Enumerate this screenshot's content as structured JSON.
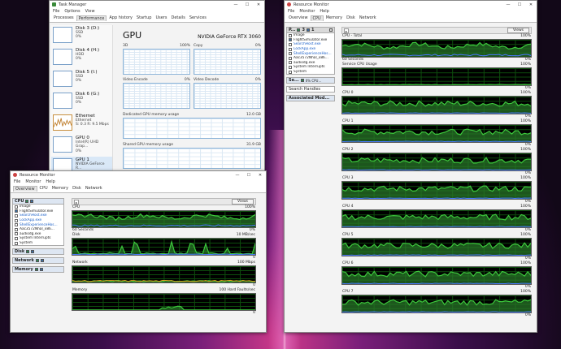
{
  "colors": {
    "graph_line": "#3cc83c",
    "graph_fill": "#2a7a2a",
    "graph_blue": "#4a7aff",
    "graph_orange": "#d8a020"
  },
  "task_manager": {
    "title": "Task Manager",
    "menu": [
      "File",
      "Options",
      "View"
    ],
    "tabs": [
      "Processes",
      "Performance",
      "App history",
      "Startup",
      "Users",
      "Details",
      "Services"
    ],
    "active_tab": "Performance",
    "devices": [
      {
        "name": "Disk 3 (D:)",
        "sub": "SSD",
        "val": "0%"
      },
      {
        "name": "Disk 4 (H:)",
        "sub": "HDD",
        "val": "0%"
      },
      {
        "name": "Disk 5 (I:)",
        "sub": "SSD",
        "val": "0%"
      },
      {
        "name": "Disk 6 (G:)",
        "sub": "SSD",
        "val": "0%"
      },
      {
        "name": "Ethernet",
        "sub": "Ethernet",
        "val": "S: 0.3 R: 9.5 Mbps"
      },
      {
        "name": "GPU 0",
        "sub": "Intel(R) UHD Grap...",
        "val": "0%"
      },
      {
        "name": "GPU 1",
        "sub": "NVIDIA GeForce R...",
        "val": "3% (53 °C)"
      }
    ],
    "gpu_heading": "GPU",
    "gpu_name": "NVIDIA GeForce RTX 3060",
    "engines": [
      {
        "name": "3D",
        "val": "100%",
        "right": "0%"
      },
      {
        "name": "Copy",
        "val": "",
        "right": "0%"
      },
      {
        "name": "Video Encode",
        "val": "",
        "right": "0%"
      },
      {
        "name": "Video Decode",
        "val": "",
        "right": "0%"
      }
    ],
    "dedicated_label": "Dedicated GPU memory usage",
    "dedicated_max": "12.0 GB",
    "shared_label": "Shared GPU memory usage",
    "shared_max": "31.9 GB"
  },
  "rm_large": {
    "title": "Resource Monitor",
    "menu": [
      "File",
      "Monitor",
      "Help"
    ],
    "tabs": [
      "Overview",
      "CPU",
      "Memory",
      "Disk",
      "Network"
    ],
    "active_tab": "CPU",
    "proc_header": "P...",
    "proc_header_stat": "3",
    "proc_header_stat2": "1",
    "processes": [
      {
        "name": "Image",
        "checked": false,
        "blue": false
      },
      {
        "name": "FlightSimulator.exe",
        "checked": true,
        "blue": false
      },
      {
        "name": "SearchHost.exe",
        "checked": false,
        "blue": true
      },
      {
        "name": "LockApp.exe",
        "checked": false,
        "blue": true
      },
      {
        "name": "ShellExperienceHos...",
        "checked": false,
        "blue": true
      },
      {
        "name": "Aac3572Nhal_x86...",
        "checked": false,
        "blue": false
      },
      {
        "name": "audiodg.exe",
        "checked": false,
        "blue": false
      },
      {
        "name": "System Interrupts",
        "checked": false,
        "blue": false
      },
      {
        "name": "System",
        "checked": false,
        "blue": false
      }
    ],
    "services_header": "Se...",
    "services_stat": "0% CPU...",
    "handles_label": "Search Handles",
    "modules_label": "Associated Mod...",
    "views_label": "Views",
    "graphs": [
      {
        "title": "CPU - Total",
        "max": "100%",
        "foot_left": "60 Seconds",
        "foot_right": "0%",
        "kind": "total"
      },
      {
        "title": "Service CPU Usage",
        "max": "100%",
        "foot_left": "",
        "foot_right": "0%",
        "kind": "service"
      },
      {
        "title": "CPU 0",
        "max": "100%",
        "foot_left": "",
        "foot_right": "0%",
        "kind": "core"
      },
      {
        "title": "CPU 1",
        "max": "100%",
        "foot_left": "",
        "foot_right": "0%",
        "kind": "core"
      },
      {
        "title": "CPU 2",
        "max": "100%",
        "foot_left": "",
        "foot_right": "0%",
        "kind": "core"
      },
      {
        "title": "CPU 3",
        "max": "100%",
        "foot_left": "",
        "foot_right": "0%",
        "kind": "core"
      },
      {
        "title": "CPU 4",
        "max": "100%",
        "foot_left": "",
        "foot_right": "0%",
        "kind": "core"
      },
      {
        "title": "CPU 5",
        "max": "100%",
        "foot_left": "",
        "foot_right": "0%",
        "kind": "core"
      },
      {
        "title": "CPU 6",
        "max": "100%",
        "foot_left": "",
        "foot_right": "0%",
        "kind": "core"
      },
      {
        "title": "CPU 7",
        "max": "100%",
        "foot_left": "",
        "foot_right": "0%",
        "kind": "core"
      }
    ]
  },
  "rm_small": {
    "title": "Resource Monitor",
    "menu": [
      "File",
      "Monitor",
      "Help"
    ],
    "tabs": [
      "Overview",
      "CPU",
      "Memory",
      "Disk",
      "Network"
    ],
    "active_tab": "Overview",
    "cpu_header": "CPU",
    "processes": [
      {
        "name": "Image",
        "checked": false,
        "blue": false
      },
      {
        "name": "FlightSimulator.exe",
        "checked": true,
        "blue": false
      },
      {
        "name": "SearchHost.exe",
        "checked": false,
        "blue": true
      },
      {
        "name": "LockApp.exe",
        "checked": false,
        "blue": true
      },
      {
        "name": "ShellExperienceHos...",
        "checked": false,
        "blue": true
      },
      {
        "name": "Aac3572Nhal_x86...",
        "checked": false,
        "blue": false
      },
      {
        "name": "audiodg.exe",
        "checked": false,
        "blue": false
      },
      {
        "name": "System Interrupts",
        "checked": false,
        "blue": false
      },
      {
        "name": "System",
        "checked": false,
        "blue": false
      }
    ],
    "panels": [
      "Disk",
      "Network",
      "Memory"
    ],
    "views_label": "Views",
    "graphs": [
      {
        "title": "CPU",
        "max": "100%",
        "foot_left": "60 Seconds",
        "foot_right": "0%",
        "kind": "total"
      },
      {
        "title": "Disk",
        "max": "10 MB/sec",
        "foot_left": "",
        "foot_right": "0",
        "kind": "disk"
      },
      {
        "title": "Network",
        "max": "100 Mbps",
        "foot_left": "",
        "foot_right": "0",
        "kind": "net"
      },
      {
        "title": "Memory",
        "max": "100 Hard Faults/sec",
        "foot_left": "",
        "foot_right": "0",
        "kind": "mem"
      }
    ]
  }
}
